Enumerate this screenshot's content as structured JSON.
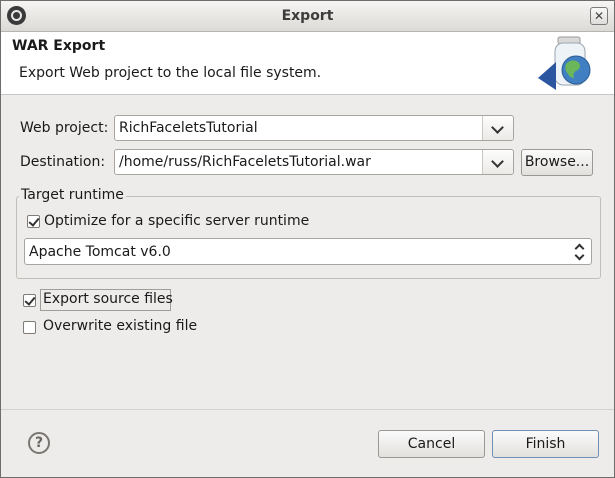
{
  "window": {
    "title": "Export"
  },
  "banner": {
    "heading": "WAR Export",
    "description": "Export Web project to the local file system."
  },
  "form": {
    "web_project_label": "Web project:",
    "web_project_value": "RichFaceletsTutorial",
    "destination_label": "Destination:",
    "destination_value": "/home/russ/RichFaceletsTutorial.war",
    "browse_label": "Browse..."
  },
  "target_runtime": {
    "group_title": "Target runtime",
    "optimize_label": "Optimize for a specific server runtime",
    "optimize_checked": true,
    "runtime_value": "Apache Tomcat v6.0"
  },
  "options": {
    "export_source_label": "Export source files",
    "export_source_checked": true,
    "overwrite_label": "Overwrite existing file",
    "overwrite_checked": false
  },
  "footer": {
    "help_symbol": "?",
    "cancel_label": "Cancel",
    "finish_label": "Finish"
  },
  "icons": {
    "window_icon": "eclipse-icon",
    "close_icon": "close-icon",
    "wizard_icon": "jar-globe-icon",
    "help_icon": "help-icon"
  }
}
